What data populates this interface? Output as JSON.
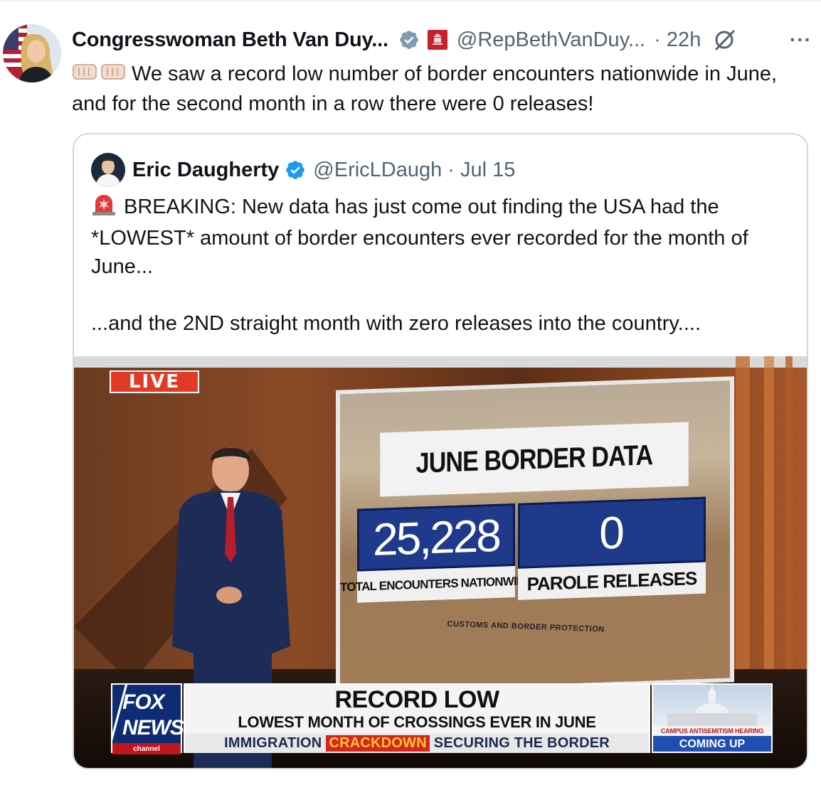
{
  "post": {
    "author_name": "Congresswoman Beth Van Duy...",
    "handle": "@RepBethVanDuy...",
    "time": "· 22h",
    "more_label": "···",
    "text": "We saw a record low number of border encounters nationwide in June, and for the second month in a row there were 0 releases!"
  },
  "quote": {
    "author_name": "Eric Daugherty",
    "handle": "@EricLDaugh",
    "separator": "·",
    "time": "Jul 15",
    "line1": "BREAKING: New data has just come out finding the USA had the *LOWEST* amount of border encounters ever recorded for the month of June...",
    "line2": "...and the 2ND straight month with zero releases into the country...."
  },
  "media": {
    "live": "LIVE",
    "screen_title": "JUNE BORDER DATA",
    "stat1_value": "25,228",
    "stat1_label": "TOTAL ENCOUNTERS NATIONWIDE",
    "stat2_value": "0",
    "stat2_label": "PAROLE RELEASES",
    "cbp_text": "CUSTOMS AND BORDER PROTECTION",
    "logo_line1": "FOX",
    "logo_line2": "NEWS",
    "logo_line3": "channel",
    "chyron_title": "RECORD LOW",
    "chyron_sub": "LOWEST MONTH OF CROSSINGS EVER IN JUNE",
    "ticker_left": "IMMIGRATION",
    "ticker_highlight": "CRACKDOWN",
    "ticker_right": "SECURING THE BORDER",
    "promo_caption": "CAMPUS ANTISEMITISM HEARING",
    "promo_coming": "COMING UP"
  },
  "colors": {
    "verified_blue": "#1d9bf0",
    "gov_verified_gray": "#829aab",
    "muted_text": "#536471",
    "border": "#cfd9de"
  },
  "icons": [
    "verified-gray-icon",
    "congress-badge-icon",
    "grok-icon",
    "more-icon",
    "fist-bump-icon",
    "verified-blue-icon",
    "siren-icon"
  ]
}
